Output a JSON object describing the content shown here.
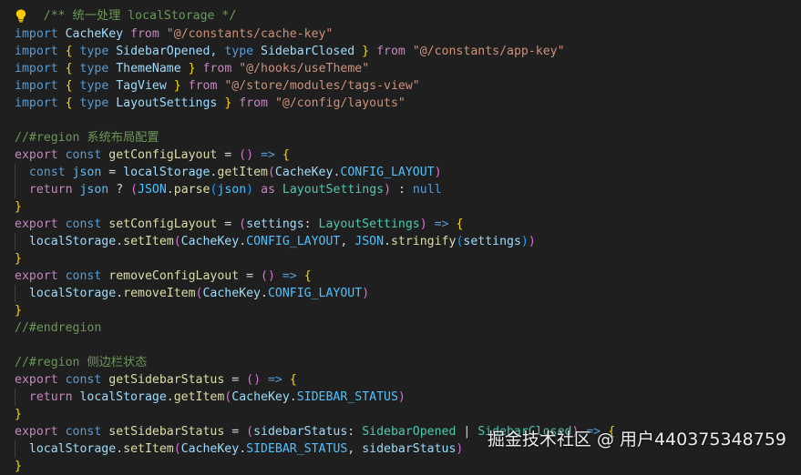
{
  "editor": {
    "top_partial": "/** 统一处理 localStorage */",
    "lines": [
      [
        [
          "import",
          "kw"
        ],
        [
          " CacheKey ",
          "var"
        ],
        [
          "from",
          "ctl"
        ],
        [
          " ",
          ""
        ],
        [
          "\"@/constants/cache-key\"",
          "str"
        ]
      ],
      [
        [
          "import",
          "kw"
        ],
        [
          " ",
          ""
        ],
        [
          "{",
          "p1"
        ],
        [
          " ",
          ""
        ],
        [
          "type",
          "kw"
        ],
        [
          " SidebarOpened, ",
          "var"
        ],
        [
          "type",
          "kw"
        ],
        [
          " SidebarClosed ",
          "var"
        ],
        [
          "}",
          "p1"
        ],
        [
          " ",
          ""
        ],
        [
          "from",
          "ctl"
        ],
        [
          " ",
          ""
        ],
        [
          "\"@/constants/app-key\"",
          "str"
        ]
      ],
      [
        [
          "import",
          "kw"
        ],
        [
          " ",
          ""
        ],
        [
          "{",
          "p1"
        ],
        [
          " ",
          ""
        ],
        [
          "type",
          "kw"
        ],
        [
          " ThemeName ",
          "var"
        ],
        [
          "}",
          "p1"
        ],
        [
          " ",
          ""
        ],
        [
          "from",
          "ctl"
        ],
        [
          " ",
          ""
        ],
        [
          "\"@/hooks/useTheme\"",
          "str"
        ]
      ],
      [
        [
          "import",
          "kw"
        ],
        [
          " ",
          ""
        ],
        [
          "{",
          "p1"
        ],
        [
          " ",
          ""
        ],
        [
          "type",
          "kw"
        ],
        [
          " TagView ",
          "var"
        ],
        [
          "}",
          "p1"
        ],
        [
          " ",
          ""
        ],
        [
          "from",
          "ctl"
        ],
        [
          " ",
          ""
        ],
        [
          "\"@/store/modules/tags-view\"",
          "str"
        ]
      ],
      [
        [
          "import",
          "kw"
        ],
        [
          " ",
          ""
        ],
        [
          "{",
          "p1"
        ],
        [
          " ",
          ""
        ],
        [
          "type",
          "kw"
        ],
        [
          " LayoutSettings ",
          "var"
        ],
        [
          "}",
          "p1"
        ],
        [
          " ",
          ""
        ],
        [
          "from",
          "ctl"
        ],
        [
          " ",
          ""
        ],
        [
          "\"@/config/layouts\"",
          "str"
        ]
      ],
      [],
      [
        [
          "//#region 系统布局配置",
          "com"
        ]
      ],
      [
        [
          "export",
          "ctl"
        ],
        [
          " ",
          ""
        ],
        [
          "const",
          "kw"
        ],
        [
          " ",
          ""
        ],
        [
          "getConfigLayout",
          "fn"
        ],
        [
          " = ",
          ""
        ],
        [
          "()",
          "p2"
        ],
        [
          " ",
          ""
        ],
        [
          "=>",
          "kw"
        ],
        [
          " ",
          ""
        ],
        [
          "{",
          "p1"
        ]
      ],
      [
        [
          "  ",
          ""
        ],
        [
          "const",
          "kw"
        ],
        [
          " ",
          ""
        ],
        [
          "json",
          "const"
        ],
        [
          " = ",
          ""
        ],
        [
          "localStorage",
          "var"
        ],
        [
          ".",
          ""
        ],
        [
          "getItem",
          "fn"
        ],
        [
          "(",
          "p2"
        ],
        [
          "CacheKey",
          "var"
        ],
        [
          ".",
          ""
        ],
        [
          "CONFIG_LAYOUT",
          "const"
        ],
        [
          ")",
          "p2"
        ]
      ],
      [
        [
          "  ",
          ""
        ],
        [
          "return",
          "ctl"
        ],
        [
          " ",
          ""
        ],
        [
          "json",
          "const"
        ],
        [
          " ? ",
          ""
        ],
        [
          "(",
          "p2"
        ],
        [
          "JSON",
          "const"
        ],
        [
          ".",
          ""
        ],
        [
          "parse",
          "fn"
        ],
        [
          "(",
          "p3"
        ],
        [
          "json",
          "const"
        ],
        [
          ")",
          "p3"
        ],
        [
          " ",
          ""
        ],
        [
          "as",
          "ctl"
        ],
        [
          " ",
          ""
        ],
        [
          "LayoutSettings",
          "type"
        ],
        [
          ")",
          "p2"
        ],
        [
          " : ",
          ""
        ],
        [
          "null",
          "kw"
        ]
      ],
      [
        [
          "}",
          "p1"
        ]
      ],
      [
        [
          "export",
          "ctl"
        ],
        [
          " ",
          ""
        ],
        [
          "const",
          "kw"
        ],
        [
          " ",
          ""
        ],
        [
          "setConfigLayout",
          "fn"
        ],
        [
          " = ",
          ""
        ],
        [
          "(",
          "p2"
        ],
        [
          "settings",
          "var"
        ],
        [
          ": ",
          ""
        ],
        [
          "LayoutSettings",
          "type"
        ],
        [
          ")",
          "p2"
        ],
        [
          " ",
          ""
        ],
        [
          "=>",
          "kw"
        ],
        [
          " ",
          ""
        ],
        [
          "{",
          "p1"
        ]
      ],
      [
        [
          "  ",
          ""
        ],
        [
          "localStorage",
          "var"
        ],
        [
          ".",
          ""
        ],
        [
          "setItem",
          "fn"
        ],
        [
          "(",
          "p2"
        ],
        [
          "CacheKey",
          "var"
        ],
        [
          ".",
          ""
        ],
        [
          "CONFIG_LAYOUT",
          "const"
        ],
        [
          ", ",
          ""
        ],
        [
          "JSON",
          "const"
        ],
        [
          ".",
          ""
        ],
        [
          "stringify",
          "fn"
        ],
        [
          "(",
          "p3"
        ],
        [
          "settings",
          "var"
        ],
        [
          ")",
          "p3"
        ],
        [
          ")",
          "p2"
        ]
      ],
      [
        [
          "}",
          "p1"
        ]
      ],
      [
        [
          "export",
          "ctl"
        ],
        [
          " ",
          ""
        ],
        [
          "const",
          "kw"
        ],
        [
          " ",
          ""
        ],
        [
          "removeConfigLayout",
          "fn"
        ],
        [
          " = ",
          ""
        ],
        [
          "()",
          "p2"
        ],
        [
          " ",
          ""
        ],
        [
          "=>",
          "kw"
        ],
        [
          " ",
          ""
        ],
        [
          "{",
          "p1"
        ]
      ],
      [
        [
          "  ",
          ""
        ],
        [
          "localStorage",
          "var"
        ],
        [
          ".",
          ""
        ],
        [
          "removeItem",
          "fn"
        ],
        [
          "(",
          "p2"
        ],
        [
          "CacheKey",
          "var"
        ],
        [
          ".",
          ""
        ],
        [
          "CONFIG_LAYOUT",
          "const"
        ],
        [
          ")",
          "p2"
        ]
      ],
      [
        [
          "}",
          "p1"
        ]
      ],
      [
        [
          "//#endregion",
          "com"
        ]
      ],
      [],
      [
        [
          "//#region 侧边栏状态",
          "com"
        ]
      ],
      [
        [
          "export",
          "ctl"
        ],
        [
          " ",
          ""
        ],
        [
          "const",
          "kw"
        ],
        [
          " ",
          ""
        ],
        [
          "getSidebarStatus",
          "fn"
        ],
        [
          " = ",
          ""
        ],
        [
          "()",
          "p2"
        ],
        [
          " ",
          ""
        ],
        [
          "=>",
          "kw"
        ],
        [
          " ",
          ""
        ],
        [
          "{",
          "p1"
        ]
      ],
      [
        [
          "  ",
          ""
        ],
        [
          "return",
          "ctl"
        ],
        [
          " ",
          ""
        ],
        [
          "localStorage",
          "var"
        ],
        [
          ".",
          ""
        ],
        [
          "getItem",
          "fn"
        ],
        [
          "(",
          "p2"
        ],
        [
          "CacheKey",
          "var"
        ],
        [
          ".",
          ""
        ],
        [
          "SIDEBAR_STATUS",
          "const"
        ],
        [
          ")",
          "p2"
        ]
      ],
      [
        [
          "}",
          "p1"
        ]
      ],
      [
        [
          "export",
          "ctl"
        ],
        [
          " ",
          ""
        ],
        [
          "const",
          "kw"
        ],
        [
          " ",
          ""
        ],
        [
          "setSidebarStatus",
          "fn"
        ],
        [
          " = ",
          ""
        ],
        [
          "(",
          "p2"
        ],
        [
          "sidebarStatus",
          "var"
        ],
        [
          ": ",
          ""
        ],
        [
          "SidebarOpened",
          "type"
        ],
        [
          " | ",
          ""
        ],
        [
          "SidebarClosed",
          "type"
        ],
        [
          ")",
          "p2"
        ],
        [
          " ",
          ""
        ],
        [
          "=>",
          "kw"
        ],
        [
          " ",
          ""
        ],
        [
          "{",
          "p1"
        ]
      ],
      [
        [
          "  ",
          ""
        ],
        [
          "localStorage",
          "var"
        ],
        [
          ".",
          ""
        ],
        [
          "setItem",
          "fn"
        ],
        [
          "(",
          "p2"
        ],
        [
          "CacheKey",
          "var"
        ],
        [
          ".",
          ""
        ],
        [
          "SIDEBAR_STATUS",
          "const"
        ],
        [
          ", ",
          ""
        ],
        [
          "sidebarStatus",
          "var"
        ],
        [
          ")",
          "p2"
        ]
      ],
      [
        [
          "}",
          "p1"
        ]
      ]
    ]
  },
  "watermark": "掘金技术社区 @ 用户440375348759",
  "icons": {
    "lightbulb": "lightbulb-icon"
  },
  "colors": {
    "background": "#1f1f1f",
    "keyword": "#569cd6",
    "control": "#c586c0",
    "string": "#ce9178",
    "comment": "#6a9955",
    "type": "#4ec9b0",
    "function": "#dcdcaa",
    "variable": "#9cdcfe",
    "constant": "#4fc1ff"
  }
}
